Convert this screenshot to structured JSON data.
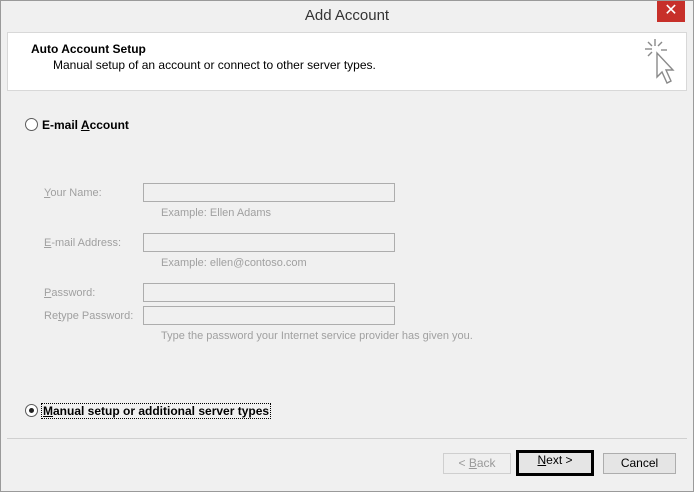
{
  "window": {
    "title": "Add Account",
    "close_glyph": "✕"
  },
  "header": {
    "title": "Auto Account Setup",
    "subtitle": "Manual setup of an account or connect to other server types.",
    "icon": "cursor-sparkle-icon"
  },
  "email_option": {
    "label_pre": "E-mail ",
    "label_accel": "A",
    "label_post": "ccount",
    "selected": false
  },
  "fields": {
    "name": {
      "label_accel": "Y",
      "label_rest": "our Name:",
      "value": "",
      "hint": "Example: Ellen Adams"
    },
    "email": {
      "label_accel": "E",
      "label_rest": "-mail Address:",
      "value": "",
      "hint": "Example: ellen@contoso.com"
    },
    "password": {
      "label_accel": "P",
      "label_rest": "assword:",
      "value": ""
    },
    "retype": {
      "label_pre": "Re",
      "label_accel": "t",
      "label_rest": "ype Password:",
      "value": "",
      "hint": "Type the password your Internet service provider has given you."
    }
  },
  "manual_option": {
    "label_accel": "M",
    "label_rest": "anual setup or additional server types",
    "selected": true
  },
  "buttons": {
    "back_pre": "< ",
    "back_accel": "B",
    "back_rest": "ack",
    "next_accel": "N",
    "next_rest": "ext >",
    "cancel": "Cancel"
  }
}
